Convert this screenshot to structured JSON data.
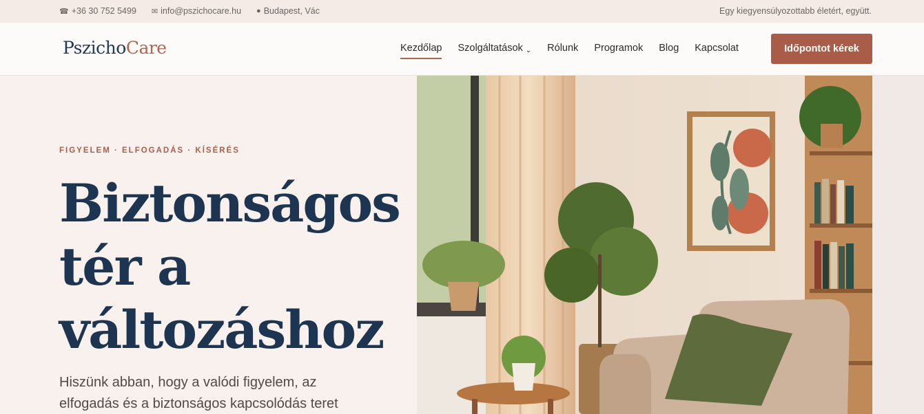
{
  "topbar": {
    "phone": "+36 30 752 5499",
    "email": "info@pszichocare.hu",
    "location": "Budapest, Vác",
    "tagline": "Egy kiegyensúlyozottabb életért, együtt."
  },
  "brand": {
    "part1": "Pszicho",
    "part2": "Care"
  },
  "nav": {
    "items": [
      "Kezdőlap",
      "Szolgáltatások",
      "Rólunk",
      "Programok",
      "Blog",
      "Kapcsolat"
    ],
    "active": "Kezdőlap",
    "cta": "Időpontot kérek"
  },
  "hero": {
    "eyebrow": "FIGYELEM · ELFOGADÁS · KÍSÉRÉS",
    "headline": [
      "Biztonságos",
      "tér a",
      "változáshoz"
    ],
    "lead": "Hiszünk abban, hogy a valódi figyelem, az elfogadás és a biztonságos kapcsolódás teret"
  },
  "colors": {
    "navy": "#1d3550",
    "terracotta": "#a95d48",
    "background": "#f8f1ee"
  },
  "icons": {
    "phone": "phone-icon",
    "email": "mail-icon",
    "location": "dot-icon",
    "chevron": "chevron-down-icon"
  }
}
